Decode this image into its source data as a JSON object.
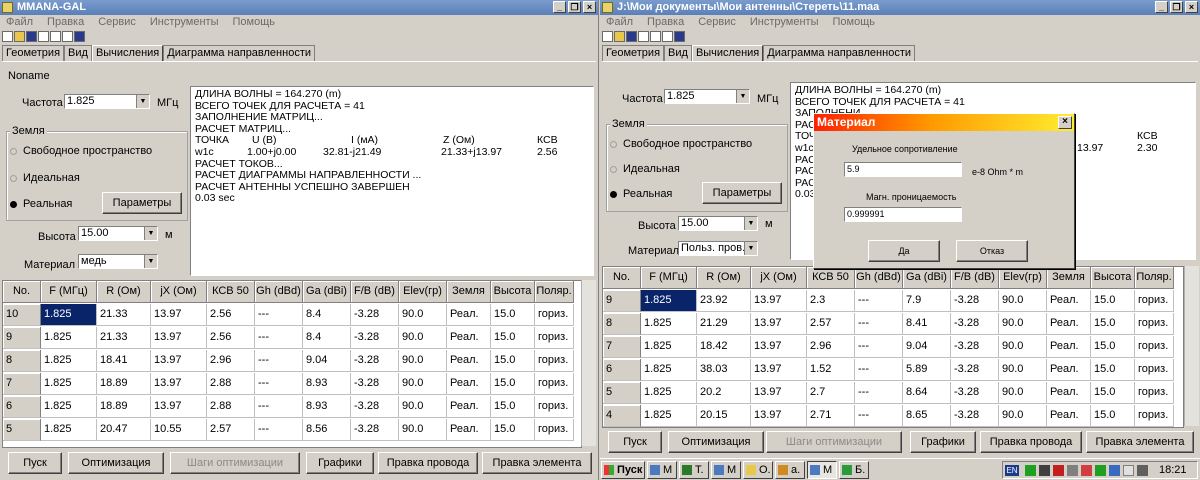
{
  "left": {
    "title": "MMANA-GAL",
    "menu": [
      "Файл",
      "Правка",
      "Сервис",
      "Инструменты",
      "Помощь"
    ],
    "tabs": [
      "Геометрия",
      "Вид",
      "Вычисления",
      "Диаграмма направленности"
    ],
    "active_tab": "Вычисления",
    "antenna_name": "Noname",
    "freq_label": "Частота",
    "freq_value": "1.825",
    "freq_unit": "МГц",
    "ground_label": "Земля",
    "ground_options": [
      "Свободное пространство",
      "Идеальная",
      "Реальная"
    ],
    "ground_selected": "Реальная",
    "params_button": "Параметры",
    "height_label": "Высота",
    "height_value": "15.00",
    "height_unit": "м",
    "material_label": "Материал",
    "material_value": "медь",
    "log": {
      "lines_top": [
        "ДЛИНА ВОЛНЫ = 164.270 (m)",
        "ВСЕГО ТОЧЕК ДЛЯ РАСЧЕТА = 41",
        "ЗАПОЛНЕНИЕ МАТРИЦ...",
        "РАСЧЕТ МАТРИЦ..."
      ],
      "table_header": [
        "ТОЧКА",
        "U (В)",
        "I (мА)",
        "Z (Ом)",
        "КСВ"
      ],
      "table_row": [
        "w1c",
        "1.00+j0.00",
        "32.81-j21.49",
        "21.33+j13.97",
        "2.56"
      ],
      "lines_bottom": [
        "РАСЧЕТ ТОКОВ...",
        "РАСЧЕТ ДИАГРАММЫ НАПРАВЛЕННОСТИ ...",
        "РАСЧЕТ АНТЕННЫ УСПЕШНО ЗАВЕРШЕН",
        "0.03 sec"
      ]
    },
    "table": {
      "columns": [
        "No.",
        "F (МГц)",
        "R (Ом)",
        "jX (Ом)",
        "КСВ 50",
        "Gh (dBd)",
        "Ga (dBi)",
        "F/B (dB)",
        "Elev(гр)",
        "Земля",
        "Высота",
        "Поляр."
      ],
      "rows": [
        [
          "10",
          "1.825",
          "21.33",
          "13.97",
          "2.56",
          "---",
          "8.4",
          "-3.28",
          "90.0",
          "Реал.",
          "15.0",
          "гориз."
        ],
        [
          "9",
          "1.825",
          "21.33",
          "13.97",
          "2.56",
          "---",
          "8.4",
          "-3.28",
          "90.0",
          "Реал.",
          "15.0",
          "гориз."
        ],
        [
          "8",
          "1.825",
          "18.41",
          "13.97",
          "2.96",
          "---",
          "9.04",
          "-3.28",
          "90.0",
          "Реал.",
          "15.0",
          "гориз."
        ],
        [
          "7",
          "1.825",
          "18.89",
          "13.97",
          "2.88",
          "---",
          "8.93",
          "-3.28",
          "90.0",
          "Реал.",
          "15.0",
          "гориз."
        ],
        [
          "6",
          "1.825",
          "18.89",
          "13.97",
          "2.88",
          "---",
          "8.93",
          "-3.28",
          "90.0",
          "Реал.",
          "15.0",
          "гориз."
        ],
        [
          "5",
          "1.825",
          "20.47",
          "10.55",
          "2.57",
          "---",
          "8.56",
          "-3.28",
          "90.0",
          "Реал.",
          "15.0",
          "гориз."
        ]
      ]
    },
    "buttons": [
      "Пуск",
      "Оптимизация",
      "Шаги оптимизации",
      "Графики",
      "Правка провода",
      "Правка элемента"
    ]
  },
  "right": {
    "title": "J:\\Мои документы\\Мои антенны\\Стереть\\11.maa",
    "menu": [
      "Файл",
      "Правка",
      "Сервис",
      "Инструменты",
      "Помощь"
    ],
    "tabs": [
      "Геометрия",
      "Вид",
      "Вычисления",
      "Диаграмма направленности"
    ],
    "freq_label": "Частота",
    "freq_value": "1.825",
    "freq_unit": "МГц",
    "ground_label": "Земля",
    "ground_options": [
      "Свободное пространство",
      "Идеальная",
      "Реальная"
    ],
    "params_button": "Параметры",
    "height_label": "Высота",
    "height_value": "15.00",
    "height_unit": "м",
    "material_label": "Материал",
    "material_value": "Польз. пров.",
    "log": {
      "lines": [
        "ДЛИНА ВОЛНЫ = 164.270 (m)",
        "ВСЕГО ТОЧЕК ДЛЯ РАСЧЕТА = 41",
        "ЗАПОЛНЕНИ",
        "РАСЧЕТ МАТРИЦ",
        "ТОЧ",
        "w1c",
        "РАС",
        "РАС",
        "РАС",
        "0.03"
      ],
      "fragments": [
        "КСВ",
        "13.97",
        "2.30"
      ]
    },
    "table": {
      "columns": [
        "No.",
        "F (МГц)",
        "R (Ом)",
        "jX (Ом)",
        "КСВ 50",
        "Gh (dBd)",
        "Ga (dBi)",
        "F/B (dB)",
        "Elev(гр)",
        "Земля",
        "Высота",
        "Поляр."
      ],
      "rows": [
        [
          "9",
          "1.825",
          "23.92",
          "13.97",
          "2.3",
          "---",
          "7.9",
          "-3.28",
          "90.0",
          "Реал.",
          "15.0",
          "гориз."
        ],
        [
          "8",
          "1.825",
          "21.29",
          "13.97",
          "2.57",
          "---",
          "8.41",
          "-3.28",
          "90.0",
          "Реал.",
          "15.0",
          "гориз."
        ],
        [
          "7",
          "1.825",
          "18.42",
          "13.97",
          "2.96",
          "---",
          "9.04",
          "-3.28",
          "90.0",
          "Реал.",
          "15.0",
          "гориз."
        ],
        [
          "6",
          "1.825",
          "38.03",
          "13.97",
          "1.52",
          "---",
          "5.89",
          "-3.28",
          "90.0",
          "Реал.",
          "15.0",
          "гориз."
        ],
        [
          "5",
          "1.825",
          "20.2",
          "13.97",
          "2.7",
          "---",
          "8.64",
          "-3.28",
          "90.0",
          "Реал.",
          "15.0",
          "гориз."
        ],
        [
          "4",
          "1.825",
          "20.15",
          "13.97",
          "2.71",
          "---",
          "8.65",
          "-3.28",
          "90.0",
          "Реал.",
          "15.0",
          "гориз."
        ]
      ]
    },
    "buttons": [
      "Пуск",
      "Оптимизация",
      "Шаги оптимизации",
      "Графики",
      "Правка провода",
      "Правка элемента"
    ]
  },
  "dialog": {
    "title": "Материал",
    "resistivity_label": "Удельное сопротивление",
    "resistivity_value": "5.9",
    "resistivity_unit": "e-8 Ohm * m",
    "permeability_label": "Магн. проницаемость",
    "permeability_value": "0.999991",
    "ok": "Да",
    "cancel": "Отказ"
  },
  "taskbar": {
    "start": "Пуск",
    "items": [
      "M",
      "T.",
      "M",
      "O.",
      "a.",
      "M",
      "Б."
    ],
    "lang": "EN",
    "clock": "18:21"
  }
}
